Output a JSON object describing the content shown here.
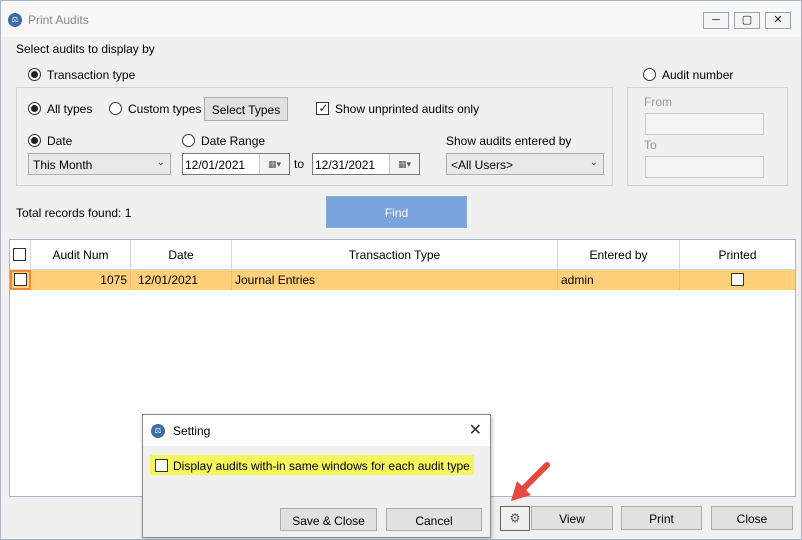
{
  "window": {
    "title": "Print Audits"
  },
  "filter": {
    "heading": "Select audits to display by",
    "transaction_type_label": "Transaction type",
    "audit_number_label": "Audit number",
    "all_types_label": "All types",
    "custom_types_label": "Custom types",
    "select_types_button": "Select Types",
    "show_unprinted_label": "Show unprinted audits only",
    "date_label": "Date",
    "date_range_label": "Date Range",
    "date_option_value": "This Month",
    "from_date": "12/01/2021",
    "to_word": "to",
    "to_date": "12/31/2021",
    "entered_by_label": "Show audits entered by",
    "entered_by_value": "<All Users>",
    "from_label": "From",
    "to_label": "To"
  },
  "total_records": "Total records found: 1",
  "find_button": "Find",
  "grid": {
    "columns": [
      "Audit Num",
      "Date",
      "Transaction Type",
      "Entered by",
      "Printed"
    ],
    "rows": [
      {
        "audit_num": "1075",
        "date": "12/01/2021",
        "transaction_type": "Journal Entries",
        "entered_by": "admin",
        "printed": false
      }
    ]
  },
  "footer": {
    "view_button": "View",
    "print_button": "Print",
    "close_button": "Close",
    "settings_icon": "gear-icon"
  },
  "setting_dialog": {
    "title": "Setting",
    "option_label": "Display audits with-in same windows for each audit type",
    "save_close_button": "Save & Close",
    "cancel_button": "Cancel"
  },
  "colors": {
    "selected_row": "#ffcf7a",
    "find_button": "#7aa5dc",
    "highlight": "#f4f65e",
    "pointer_arrow": "#e8473f"
  }
}
